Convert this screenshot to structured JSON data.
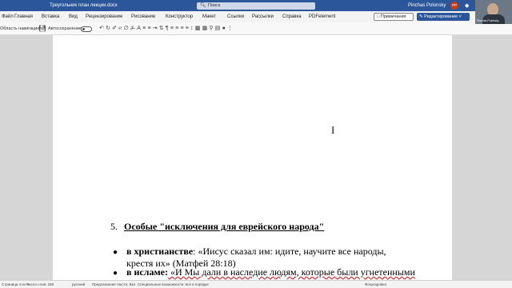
{
  "titlebar": {
    "doc_title": "Треугольник план лекции.docx",
    "search_placeholder": "Поиск",
    "search_icon": "search-icon",
    "user_name": "Pinchas Polonsky",
    "user_initials": "PP"
  },
  "menu": {
    "tabs": [
      "Файл",
      "Главная",
      "Вставка",
      "Вид",
      "Рецензирование",
      "Рисование",
      "Конструктор",
      "Макет",
      "Ссылки",
      "Рассылки",
      "Справка",
      "PDFelement"
    ],
    "comments_label": "Примечания",
    "editing_label": "Редактирование"
  },
  "toolbar": {
    "nav_label": "Область навигации",
    "autosave_label": "Автосохранение",
    "autosave_state": "off",
    "icons": [
      "undo-icon",
      "redo-icon",
      "format-painter-icon",
      "bold-icon",
      "italic-icon",
      "underline-icon",
      "font-color-icon",
      "bullets-icon",
      "numbering-icon",
      "indent-icon",
      "sort-icon",
      "paragraph-mark-icon",
      "align-left-icon",
      "align-center-icon",
      "align-right-icon",
      "justify-icon",
      "spacing-icon",
      "shading-icon",
      "borders-icon",
      "find-icon",
      "styles-icon",
      "dictate-icon",
      "more-icon"
    ]
  },
  "document": {
    "heading_number": "5.",
    "heading_text": "Особые \"исключения для еврейского народа\"",
    "bullets": [
      {
        "bold": "в христианстве",
        "rest": ": «Иисус сказал им: идите, научите все народы, крестя их» (Матфей 28:18)"
      },
      {
        "bold": "в исламе:",
        "rest": " «И Мы дали в наследие людям, которые были угнетенными"
      }
    ]
  },
  "statusbar": {
    "page": "Страница 4 из 5",
    "words": "Число слов: 258",
    "language": "русский",
    "text_predictions": "Предсказания текста: Вкл",
    "accessibility": "Специальные возможности: все в порядке",
    "focus": "Фокусировка"
  },
  "webcam": {
    "name": "Pinchas Polonsky"
  },
  "colors": {
    "accent": "#2b579a",
    "avatar": "#c43e1c",
    "page": "#ffffff",
    "canvas": "#d6d6d6"
  }
}
